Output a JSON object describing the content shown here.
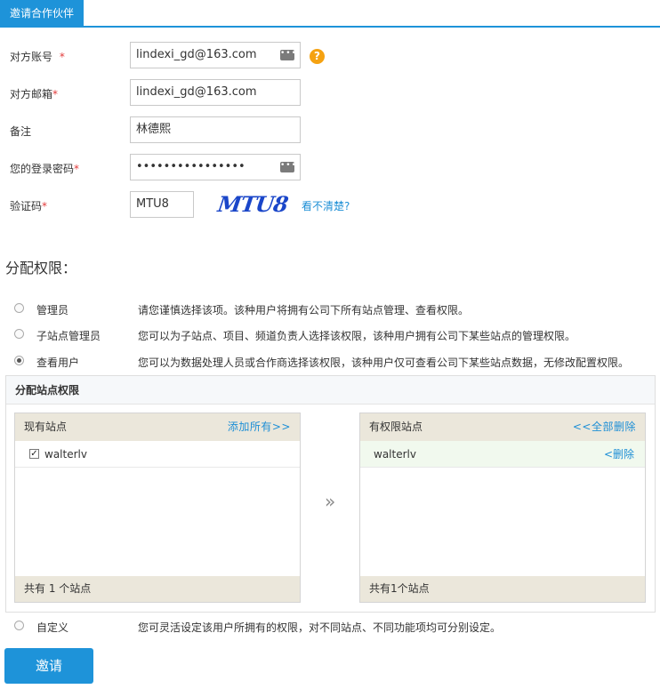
{
  "tab": {
    "label": "邀请合作伙伴"
  },
  "form": {
    "account": {
      "label": "对方账号",
      "required": "*",
      "value": "lindexi_gd@163.com"
    },
    "email": {
      "label": "对方邮箱",
      "required": "*",
      "value": "lindexi_gd@163.com"
    },
    "note": {
      "label": "备注",
      "value": "林德熙"
    },
    "password": {
      "label": "您的登录密码",
      "required": "*",
      "value": "••••••••••••••••"
    },
    "captcha": {
      "label": "验证码",
      "required": "*",
      "value": "MTU8",
      "image_text": "MTU8",
      "refresh_link": "看不清楚?"
    },
    "help_glyph": "?"
  },
  "permissions": {
    "title": "分配权限：",
    "roles": [
      {
        "name": "管理员",
        "desc": "请您谨慎选择该项。该种用户将拥有公司下所有站点管理、查看权限。",
        "checked": false
      },
      {
        "name": "子站点管理员",
        "desc": "您可以为子站点、项目、频道负责人选择该权限，该种用户拥有公司下某些站点的管理权限。",
        "checked": false
      },
      {
        "name": "查看用户",
        "desc": "您可以为数据处理人员或合作商选择该权限，该种用户仅可查看公司下某些站点数据，无修改配置权限。",
        "checked": true
      },
      {
        "name": "自定义",
        "desc": "您可灵活设定该用户所拥有的权限，对不同站点、不同功能项均可分别设定。",
        "checked": false
      }
    ],
    "site_box": {
      "title": "分配站点权限",
      "existing": {
        "header": "现有站点",
        "add_all": "添加所有>>",
        "items": [
          {
            "name": "walterlv",
            "checked": true
          }
        ],
        "footer": "共有 1 个站点"
      },
      "transfer_glyph": "»",
      "granted": {
        "header": "有权限站点",
        "remove_all": "<<全部删除",
        "items": [
          {
            "name": "walterlv",
            "remove": "<删除"
          }
        ],
        "footer": "共有1个站点"
      }
    }
  },
  "submit": {
    "label": "邀请"
  },
  "colors": {
    "accent": "#1e93d9",
    "link": "#1e8fd6",
    "required": "#e23b3b",
    "help": "#f5a212",
    "panel_head": "#ebe7db",
    "granted_row": "#f1f9ee"
  }
}
